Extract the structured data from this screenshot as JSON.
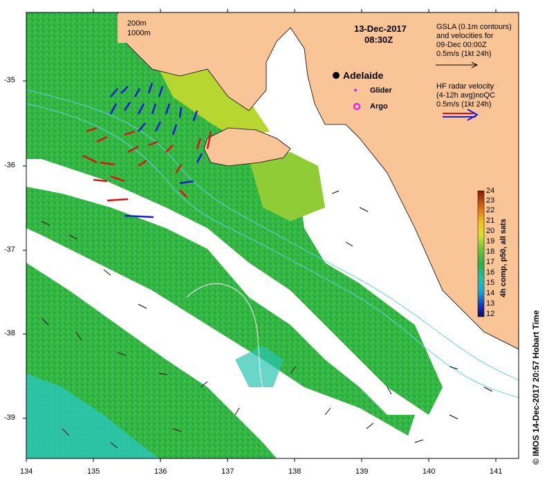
{
  "header": {
    "date": "13-Dec-2017",
    "time": "08:30Z"
  },
  "scale_legend": {
    "line_200m": "200m",
    "line_1000m": "1000m"
  },
  "gsla_legend": {
    "line1": "GSLA (0.1m contours)",
    "line2": "and velocities for",
    "line3": "09-Dec 00:00Z",
    "line4": "0.5m/s (1kt 24h)"
  },
  "hf_legend": {
    "line1": "HF radar velocity",
    "line2": "(4-12h avg)noQC",
    "line3": "0.5m/s (1kt 24h)"
  },
  "places": {
    "city": "Adelaide",
    "glider": "Glider",
    "argo": "Argo"
  },
  "colorbar": {
    "title": "4h comp, p50, all sats",
    "ticks": [
      "24",
      "23",
      "22",
      "21",
      "20",
      "19",
      "18",
      "17",
      "16",
      "15",
      "14",
      "13",
      "12"
    ]
  },
  "credit": "© IMOS 14-Dec-2017 20:57 Hobart Time",
  "axes": {
    "x_ticks": [
      "134",
      "135",
      "136",
      "137",
      "138",
      "139",
      "140",
      "141"
    ],
    "y_ticks": [
      "-35",
      "-36",
      "-37",
      "-38",
      "-39"
    ]
  },
  "colors": {
    "land": "#f9c597",
    "ocean_no_data": "#ffffff",
    "sst_main": "#2fb34a",
    "hf_radar_red": "#e01010",
    "hf_radar_blue": "#1a1ad8",
    "contour": "#5fd3e6",
    "glider": "#c030e0",
    "argo": "#ff00ff"
  }
}
